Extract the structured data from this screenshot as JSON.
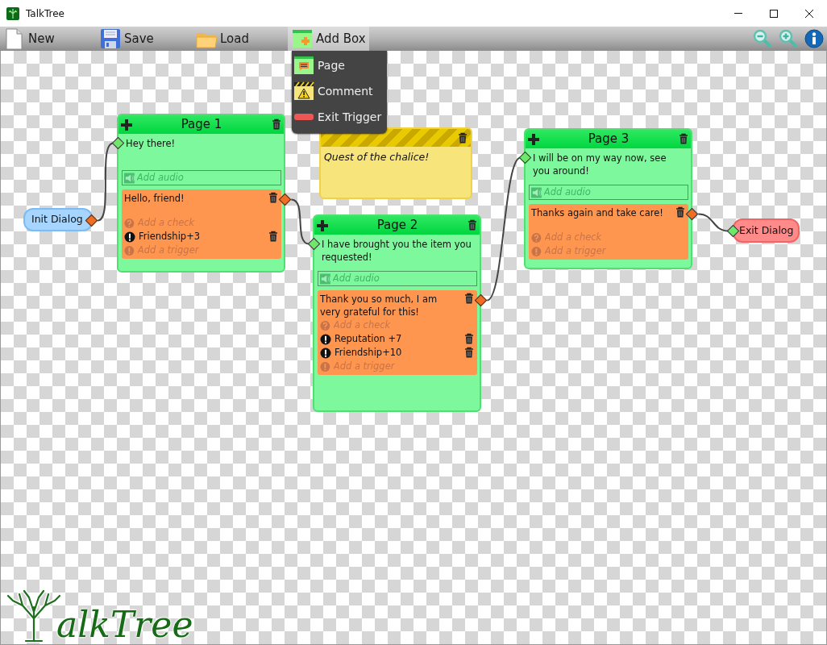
{
  "window": {
    "title": "TalkTree"
  },
  "toolbar": {
    "buttons": [
      {
        "kind": "new",
        "label": "New"
      },
      {
        "kind": "save",
        "label": "Save"
      },
      {
        "kind": "load",
        "label": "Load"
      },
      {
        "kind": "add",
        "label": "Add Box",
        "expanded": true
      }
    ],
    "menu": [
      {
        "kind": "page",
        "label": "Page"
      },
      {
        "kind": "comment",
        "label": "Comment"
      },
      {
        "kind": "exit",
        "label": "Exit Trigger"
      }
    ]
  },
  "canvas": {
    "init": {
      "label": "Init Dialog"
    },
    "comment": {
      "text": "Quest of the chalice!"
    },
    "pages": [
      {
        "title": "Page 1",
        "text": "Hey there!",
        "audio_placeholder": "Add audio",
        "responses": [
          {
            "text": "Hello, friend!",
            "check_placeholder": "Add a check",
            "triggers": [
              "Friendship+3"
            ],
            "trigger_placeholder": "Add a trigger"
          }
        ]
      },
      {
        "title": "Page 2",
        "text": "I have brought you the item you requested!",
        "audio_placeholder": "Add audio",
        "responses": [
          {
            "text": "Thank you so much, I am very grateful for this!",
            "check_placeholder": "Add a check",
            "triggers": [
              "Reputation +7",
              "Friendship+10"
            ],
            "trigger_placeholder": "Add a trigger"
          }
        ]
      },
      {
        "title": "Page 3",
        "text": "I will be on my way now, see you around!",
        "audio_placeholder": "Add audio",
        "responses": [
          {
            "text": "Thanks again and take care!",
            "check_placeholder": "Add a check",
            "trigger_placeholder": "Add a trigger"
          }
        ]
      }
    ],
    "exit": {
      "label": "Exit Dialog"
    }
  },
  "logo": {
    "text": "alkTree"
  }
}
